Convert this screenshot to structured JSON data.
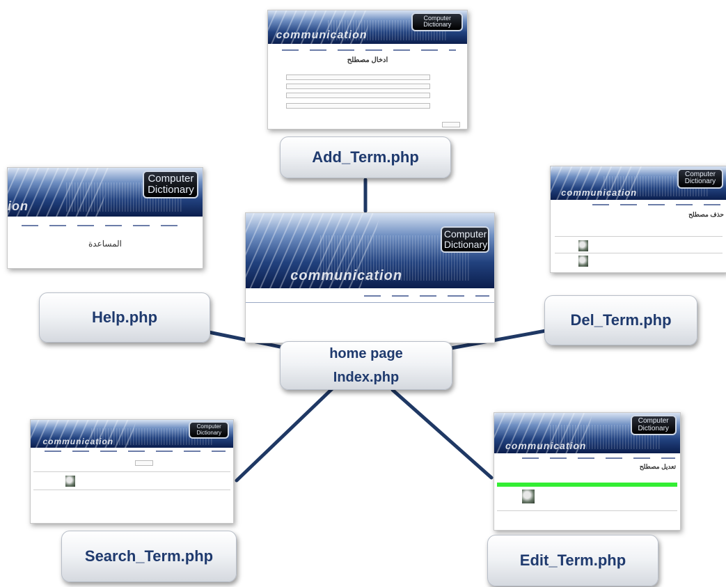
{
  "nodes": {
    "add_term": "Add_Term.php",
    "help": "Help.php",
    "del_term": "Del_Term.php",
    "home_title": "home page",
    "home_file": "Index.php",
    "search_term": "Search_Term.php",
    "edit_term": "Edit_Term.php"
  },
  "banner": {
    "logo_line1": "Computer",
    "logo_line2": "Dictionary",
    "watermark": "communication",
    "watermark_short": "ion"
  },
  "page_titles": {
    "add": "ادخال مصطلح",
    "help": "المساعدة",
    "del": "حذف مصطلح",
    "edit": "تعديل مصطلح"
  },
  "colors": {
    "connector": "#1f3864",
    "button_text": "#1f3a6e",
    "highlight_row": "#33ee33"
  }
}
